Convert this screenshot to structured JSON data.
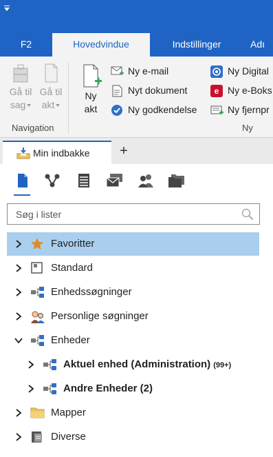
{
  "titlebar": {
    "quick_access_icon": "dropdown-arrow-icon"
  },
  "ribbon_tabs": [
    {
      "label": "F2",
      "active": false
    },
    {
      "label": "Hovedvindue",
      "active": true
    },
    {
      "label": "Indstillinger",
      "active": false
    },
    {
      "label": "Adı",
      "active": false
    }
  ],
  "ribbon": {
    "navigation": {
      "group_label": "Navigation",
      "go_to_case": {
        "line1": "Gå til",
        "line2": "sag"
      },
      "go_to_doc": {
        "line1": "Gå til",
        "line2": "akt"
      }
    },
    "new_group": {
      "group_label": "Ny",
      "new_record": {
        "line1": "Ny",
        "line2": "akt"
      },
      "items_col1": [
        {
          "label": "Ny e-mail",
          "icon": "envelope-plus-icon"
        },
        {
          "label": "Nyt dokument",
          "icon": "document-icon"
        },
        {
          "label": "Ny godkendelse",
          "icon": "checkmark-circle-icon"
        }
      ],
      "items_col2": [
        {
          "label": "Ny Digital",
          "icon": "at-sign-icon"
        },
        {
          "label": "Ny e-Boks",
          "icon": "eboks-icon"
        },
        {
          "label": "Ny fjernpr",
          "icon": "remote-print-icon"
        }
      ]
    }
  },
  "doc_tabs": {
    "inbox_tab": {
      "label": "Min indbakke",
      "icon": "inbox-icon"
    },
    "add_tab_label": "+"
  },
  "panel": {
    "icons": [
      "documents-icon",
      "flow-icon",
      "list-icon",
      "mail-stack-icon",
      "persons-icon",
      "folders-icon"
    ],
    "search": {
      "placeholder": "Søg i lister",
      "icon": "search-icon"
    },
    "tree": [
      {
        "label": "Favoritter",
        "icon": "star-icon",
        "expanded": false,
        "selected": true
      },
      {
        "label": "Standard",
        "icon": "standard-box-icon",
        "expanded": false
      },
      {
        "label": "Enhedssøgninger",
        "icon": "unit-tree-icon",
        "expanded": false
      },
      {
        "label": "Personlige søgninger",
        "icon": "persons-icon",
        "expanded": false
      },
      {
        "label": "Enheder",
        "icon": "unit-tree-icon",
        "expanded": true
      },
      {
        "label": "Aktuel enhed (Administration)",
        "icon": "unit-tree-icon",
        "badge": "99+",
        "child": true
      },
      {
        "label": "Andre Enheder (2)",
        "icon": "unit-tree-icon",
        "child": true
      },
      {
        "label": "Mapper",
        "icon": "folder-icon",
        "expanded": false
      },
      {
        "label": "Diverse",
        "icon": "diverse-icon",
        "expanded": false
      }
    ]
  },
  "colors": {
    "accent": "#1f64c4",
    "selected_row": "#aacfee",
    "ribbon_bg": "#f3f3f3"
  }
}
